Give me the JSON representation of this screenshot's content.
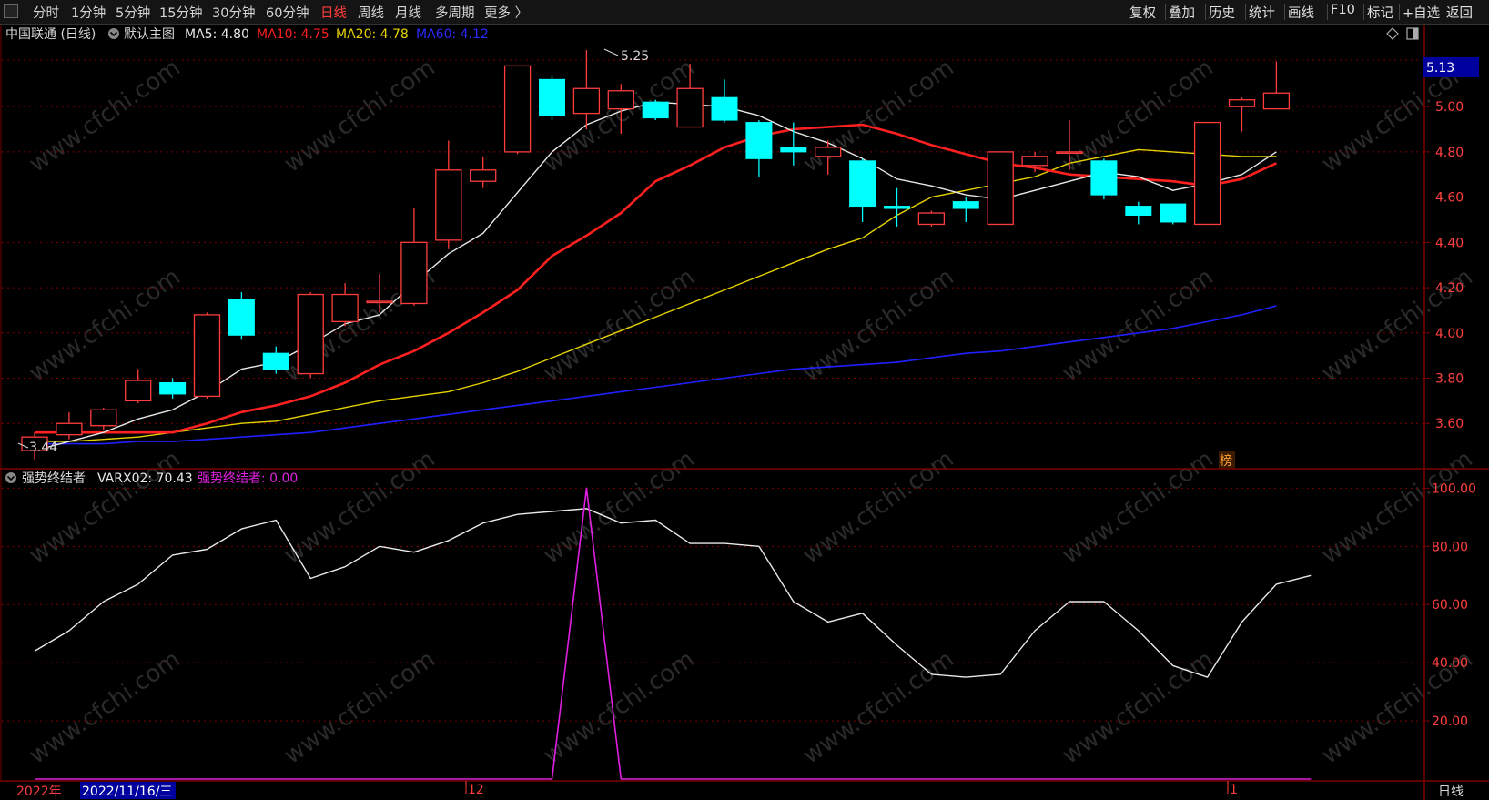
{
  "toolbar": {
    "left": [
      {
        "label": "分时",
        "active": false
      },
      {
        "label": "1分钟",
        "active": false
      },
      {
        "label": "5分钟",
        "active": false
      },
      {
        "label": "15分钟",
        "active": false
      },
      {
        "label": "30分钟",
        "active": false
      },
      {
        "label": "60分钟",
        "active": false
      },
      {
        "label": "日线",
        "active": true
      },
      {
        "label": "周线",
        "active": false
      },
      {
        "label": "月线",
        "active": false
      },
      {
        "label": "多周期",
        "active": false
      },
      {
        "label": "更多 〉",
        "active": false
      }
    ],
    "right": [
      "复权",
      "叠加",
      "历史",
      "统计",
      "画线",
      "F10",
      "标记",
      "+自选",
      "返回"
    ]
  },
  "main_legend": {
    "stock": "中国联通 (日线)",
    "template": "默认主图",
    "ma5": "MA5: 4.80",
    "ma10": "MA10: 4.75",
    "ma20": "MA20: 4.78",
    "ma60": "MA60: 4.12"
  },
  "sub_legend": {
    "name": "强势终结者",
    "varx": "VARX02: 70.43",
    "signal": "强势终结者: 0.00"
  },
  "annotations": {
    "high": "5.25",
    "low": "3.44",
    "current_price": "5.13",
    "marker": "榜"
  },
  "time_axis": {
    "year": "2022年",
    "cursor_date": "2022/11/16/三",
    "month_dec": "12",
    "month_jan": "1",
    "period": "日线"
  },
  "watermark": "www.cfchi.com",
  "colors": {
    "up": "#ff3c3c",
    "down": "#00ffff",
    "ma5": "#e8e8e8",
    "ma10": "#ff2020",
    "ma20": "#e6d200",
    "ma60": "#2020ff",
    "varx": "#e8e8e8",
    "signal": "#e020e0",
    "grid": "#7a0000"
  },
  "chart_data": [
    {
      "type": "candlestick",
      "title": "中国联通 (日线)",
      "y_ticks": [
        3.6,
        3.8,
        4.0,
        4.2,
        4.4,
        4.6,
        4.8,
        5.0
      ],
      "ylim": [
        3.42,
        5.25
      ],
      "candles": [
        {
          "o": 3.48,
          "c": 3.54,
          "h": 3.56,
          "l": 3.44
        },
        {
          "o": 3.55,
          "c": 3.6,
          "h": 3.65,
          "l": 3.53
        },
        {
          "o": 3.59,
          "c": 3.66,
          "h": 3.67,
          "l": 3.57
        },
        {
          "o": 3.7,
          "c": 3.79,
          "h": 3.84,
          "l": 3.69
        },
        {
          "o": 3.78,
          "c": 3.73,
          "h": 3.8,
          "l": 3.71
        },
        {
          "o": 3.72,
          "c": 4.08,
          "h": 4.09,
          "l": 3.71
        },
        {
          "o": 4.15,
          "c": 3.99,
          "h": 4.18,
          "l": 3.97
        },
        {
          "o": 3.91,
          "c": 3.84,
          "h": 3.94,
          "l": 3.82
        },
        {
          "o": 3.82,
          "c": 4.17,
          "h": 4.18,
          "l": 3.8
        },
        {
          "o": 4.05,
          "c": 4.17,
          "h": 4.22,
          "l": 4.03
        },
        {
          "o": 4.14,
          "c": 4.14,
          "h": 4.26,
          "l": 4.09
        },
        {
          "o": 4.13,
          "c": 4.4,
          "h": 4.55,
          "l": 4.12
        },
        {
          "o": 4.41,
          "c": 4.72,
          "h": 4.85,
          "l": 4.37
        },
        {
          "o": 4.67,
          "c": 4.72,
          "h": 4.78,
          "l": 4.64
        },
        {
          "o": 4.8,
          "c": 5.18,
          "h": 5.18,
          "l": 4.79
        },
        {
          "o": 5.12,
          "c": 4.96,
          "h": 5.14,
          "l": 4.94
        },
        {
          "o": 4.97,
          "c": 5.08,
          "h": 5.25,
          "l": 4.9
        },
        {
          "o": 4.99,
          "c": 5.07,
          "h": 5.1,
          "l": 4.88
        },
        {
          "o": 5.02,
          "c": 4.95,
          "h": 5.03,
          "l": 4.94
        },
        {
          "o": 4.91,
          "c": 5.08,
          "h": 5.19,
          "l": 4.91
        },
        {
          "o": 5.04,
          "c": 4.94,
          "h": 5.12,
          "l": 4.93
        },
        {
          "o": 4.93,
          "c": 4.77,
          "h": 4.94,
          "l": 4.69
        },
        {
          "o": 4.82,
          "c": 4.8,
          "h": 4.93,
          "l": 4.74
        },
        {
          "o": 4.78,
          "c": 4.82,
          "h": 4.85,
          "l": 4.7
        },
        {
          "o": 4.76,
          "c": 4.56,
          "h": 4.77,
          "l": 4.49
        },
        {
          "o": 4.56,
          "c": 4.55,
          "h": 4.64,
          "l": 4.47
        },
        {
          "o": 4.48,
          "c": 4.53,
          "h": 4.54,
          "l": 4.47
        },
        {
          "o": 4.58,
          "c": 4.55,
          "h": 4.6,
          "l": 4.49
        },
        {
          "o": 4.48,
          "c": 4.8,
          "h": 4.8,
          "l": 4.48
        },
        {
          "o": 4.74,
          "c": 4.78,
          "h": 4.8,
          "l": 4.71
        },
        {
          "o": 4.8,
          "c": 4.8,
          "h": 4.94,
          "l": 4.72
        },
        {
          "o": 4.76,
          "c": 4.61,
          "h": 4.77,
          "l": 4.59
        },
        {
          "o": 4.56,
          "c": 4.52,
          "h": 4.58,
          "l": 4.48
        },
        {
          "o": 4.57,
          "c": 4.49,
          "h": 4.57,
          "l": 4.48
        },
        {
          "o": 4.48,
          "c": 4.93,
          "h": 4.93,
          "l": 4.48
        },
        {
          "o": 5.0,
          "c": 5.03,
          "h": 5.04,
          "l": 4.89
        },
        {
          "o": 4.99,
          "c": 5.06,
          "h": 5.2,
          "l": 4.99
        }
      ],
      "ma5": [
        3.48,
        3.52,
        3.56,
        3.62,
        3.66,
        3.74,
        3.84,
        3.87,
        3.95,
        4.04,
        4.08,
        4.22,
        4.35,
        4.44,
        4.62,
        4.8,
        4.92,
        4.98,
        5.02,
        5.01,
        5.0,
        4.96,
        4.89,
        4.84,
        4.77,
        4.68,
        4.65,
        4.61,
        4.59,
        4.63,
        4.67,
        4.71,
        4.69,
        4.63,
        4.66,
        4.7,
        4.8
      ],
      "ma10": [
        3.56,
        3.56,
        3.56,
        3.56,
        3.56,
        3.6,
        3.65,
        3.68,
        3.72,
        3.78,
        3.86,
        3.92,
        4.0,
        4.09,
        4.19,
        4.34,
        4.43,
        4.53,
        4.67,
        4.74,
        4.82,
        4.87,
        4.9,
        4.91,
        4.92,
        4.88,
        4.83,
        4.79,
        4.75,
        4.73,
        4.7,
        4.69,
        4.68,
        4.67,
        4.65,
        4.68,
        4.75
      ],
      "ma20": [
        3.52,
        3.52,
        3.53,
        3.54,
        3.56,
        3.58,
        3.6,
        3.61,
        3.64,
        3.67,
        3.7,
        3.72,
        3.74,
        3.78,
        3.83,
        3.89,
        3.95,
        4.01,
        4.07,
        4.13,
        4.19,
        4.25,
        4.31,
        4.37,
        4.42,
        4.52,
        4.6,
        4.63,
        4.66,
        4.69,
        4.75,
        4.78,
        4.81,
        4.8,
        4.79,
        4.78,
        4.78
      ],
      "ma60": [
        3.51,
        3.51,
        3.51,
        3.52,
        3.52,
        3.53,
        3.54,
        3.55,
        3.56,
        3.58,
        3.6,
        3.62,
        3.64,
        3.66,
        3.68,
        3.7,
        3.72,
        3.74,
        3.76,
        3.78,
        3.8,
        3.82,
        3.84,
        3.85,
        3.86,
        3.87,
        3.89,
        3.91,
        3.92,
        3.94,
        3.96,
        3.98,
        4.0,
        4.02,
        4.05,
        4.08,
        4.12
      ]
    },
    {
      "type": "line",
      "title": "强势终结者",
      "y_ticks": [
        20,
        40,
        60,
        80,
        100
      ],
      "ylim": [
        0,
        102
      ],
      "series": [
        {
          "name": "VARX02",
          "values": [
            44,
            51,
            61,
            67,
            77,
            79,
            86,
            89,
            69,
            73,
            80,
            78,
            82,
            88,
            91,
            92,
            93,
            88,
            89,
            81,
            81,
            80,
            61,
            54,
            57,
            46,
            36,
            35,
            36,
            51,
            61,
            61,
            51,
            39,
            35,
            54,
            67,
            70
          ]
        },
        {
          "name": "强势终结者",
          "values": [
            0,
            0,
            0,
            0,
            0,
            0,
            0,
            0,
            0,
            0,
            0,
            0,
            0,
            0,
            0,
            0,
            100,
            0,
            0,
            0,
            0,
            0,
            0,
            0,
            0,
            0,
            0,
            0,
            0,
            0,
            0,
            0,
            0,
            0,
            0,
            0,
            0,
            0
          ]
        }
      ]
    }
  ]
}
